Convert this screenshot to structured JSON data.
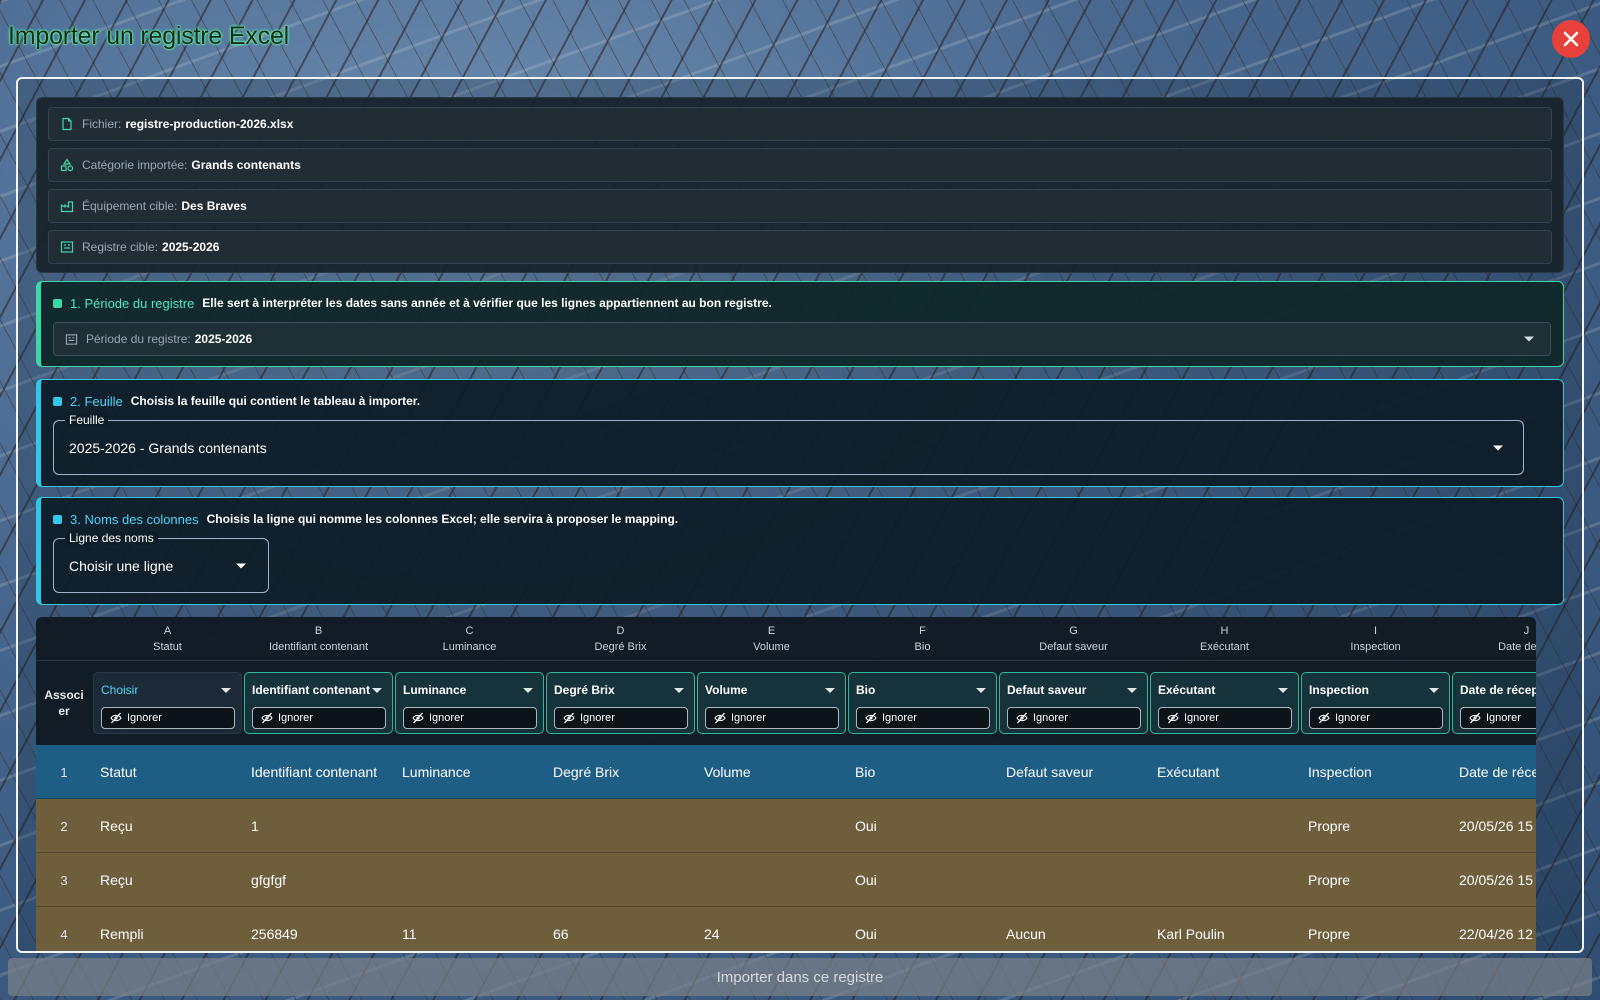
{
  "dialog": {
    "title": "Importer un registre Excel",
    "import_button": "Importer dans ce registre"
  },
  "info": [
    {
      "label": "Fichier:",
      "value": "registre-production-2026.xlsx",
      "icon": "file-icon"
    },
    {
      "label": "Catégorie importée:",
      "value": "Grands contenants",
      "icon": "category-icon"
    },
    {
      "label": "Équipement cible:",
      "value": "Des Braves",
      "icon": "factory-icon"
    },
    {
      "label": "Registre cible:",
      "value": "2025-2026",
      "icon": "register-icon"
    }
  ],
  "section1": {
    "title": "1. Période du registre",
    "description": "Elle sert à interpréter les dates sans année et à vérifier que les lignes appartiennent au bon registre.",
    "select_label": "Période du registre:",
    "select_value": "2025-2026"
  },
  "section2": {
    "title": "2. Feuille",
    "description": "Choisis la feuille qui contient le tableau à importer.",
    "field_label": "Feuille",
    "field_value": "2025-2026 - Grands contenants"
  },
  "section3": {
    "title": "3. Noms des colonnes",
    "description": "Choisis la ligne qui nomme les colonnes Excel; elle servira à proposer le mapping.",
    "field_label": "Ligne des noms",
    "field_value": "Choisir une ligne"
  },
  "table": {
    "associer_label": "Associ er",
    "ignore_label": "Ignorer",
    "columns": [
      {
        "letter": "A",
        "name": "Statut",
        "mapping": "Choisir"
      },
      {
        "letter": "B",
        "name": "Identifiant contenant",
        "mapping": "Identifiant contenant"
      },
      {
        "letter": "C",
        "name": "Luminance",
        "mapping": "Luminance"
      },
      {
        "letter": "D",
        "name": "Degré Brix",
        "mapping": "Degré Brix"
      },
      {
        "letter": "E",
        "name": "Volume",
        "mapping": "Volume"
      },
      {
        "letter": "F",
        "name": "Bio",
        "mapping": "Bio"
      },
      {
        "letter": "G",
        "name": "Defaut saveur",
        "mapping": "Defaut saveur"
      },
      {
        "letter": "H",
        "name": "Exécutant",
        "mapping": "Exécutant"
      },
      {
        "letter": "I",
        "name": "Inspection",
        "mapping": "Inspection"
      },
      {
        "letter": "J",
        "name": "Date de réc",
        "mapping": "Date de récepti"
      }
    ],
    "rows": [
      {
        "index": "1",
        "cells": [
          "Statut",
          "Identifiant contenant",
          "Luminance",
          "Degré Brix",
          "Volume",
          "Bio",
          "Defaut saveur",
          "Exécutant",
          "Inspection",
          "Date de réce"
        ]
      },
      {
        "index": "2",
        "cells": [
          "Reçu",
          "1",
          "",
          "",
          "",
          "Oui",
          "",
          "",
          "Propre",
          "20/05/26 15"
        ]
      },
      {
        "index": "3",
        "cells": [
          "Reçu",
          "gfgfgf",
          "",
          "",
          "",
          "Oui",
          "",
          "",
          "Propre",
          "20/05/26 15"
        ]
      },
      {
        "index": "4",
        "cells": [
          "Rempli",
          "256849",
          "11",
          "66",
          "24",
          "Oui",
          "Aucun",
          "Karl Poulin",
          "Propre",
          "22/04/26 12"
        ]
      }
    ]
  }
}
